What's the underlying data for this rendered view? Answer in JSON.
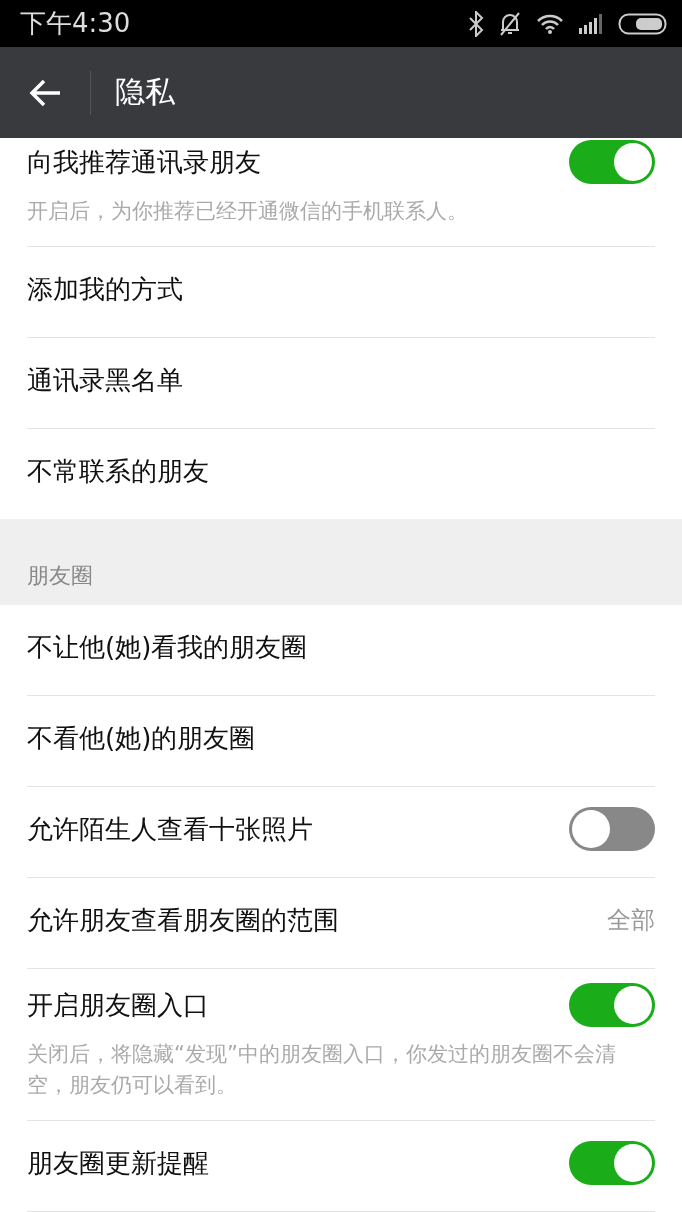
{
  "status_bar": {
    "time": "下午4:30"
  },
  "toolbar": {
    "title": "隐私"
  },
  "sections": [
    {
      "items": [
        {
          "kind": "toggle",
          "label": "向我推荐通讯录朋友",
          "on": true,
          "description": "开启后，为你推荐已经开通微信的手机联系人。"
        },
        {
          "kind": "link",
          "label": "添加我的方式"
        },
        {
          "kind": "link",
          "label": "通讯录黑名单"
        },
        {
          "kind": "link",
          "label": "不常联系的朋友"
        }
      ]
    },
    {
      "header": "朋友圈",
      "items": [
        {
          "kind": "link",
          "label": "不让他(她)看我的朋友圈"
        },
        {
          "kind": "link",
          "label": "不看他(她)的朋友圈"
        },
        {
          "kind": "toggle",
          "label": "允许陌生人查看十张照片",
          "on": false
        },
        {
          "kind": "value",
          "label": "允许朋友查看朋友圈的范围",
          "value": "全部"
        },
        {
          "kind": "toggle",
          "label": "开启朋友圈入口",
          "on": true,
          "description": "关闭后，将隐藏“发现”中的朋友圈入口，你发过的朋友圈不会清空，朋友仍可以看到。"
        },
        {
          "kind": "toggle",
          "label": "朋友圈更新提醒",
          "on": true
        }
      ]
    }
  ]
}
